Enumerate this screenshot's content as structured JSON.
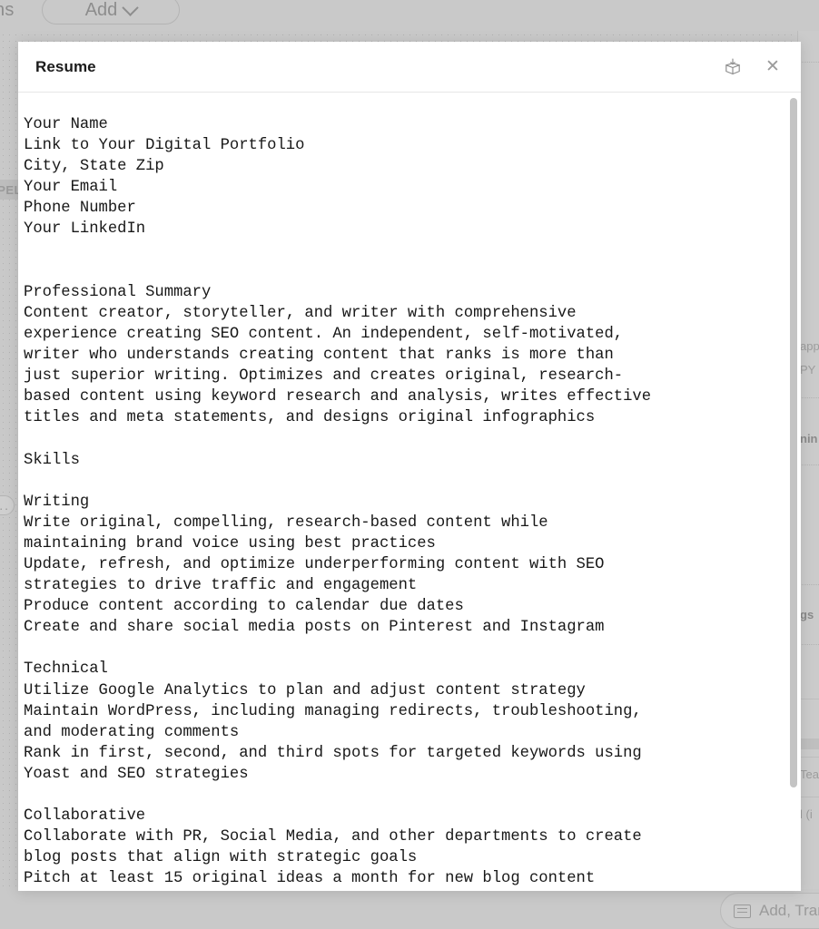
{
  "background": {
    "toolbar_fragment_label": "ns",
    "add_button_label": "Add",
    "add_button_icon": "chevron-down-icon",
    "left_panel_fragment": "PEL",
    "left_pill_label": "..",
    "right_fragments": [
      "app",
      "PY",
      "nin",
      "gs",
      "Tea",
      "l (i"
    ],
    "transfer_button_label": "Add, Transfe",
    "transfer_button_icon": "note-icon"
  },
  "modal": {
    "title": "Resume",
    "archive_icon": "archive-box-download-icon",
    "close_icon": "close-icon",
    "scrollbar": {
      "orientation": "vertical",
      "thumb_position_percent": 0
    },
    "document": {
      "content": "Your Name\nLink to Your Digital Portfolio\nCity, State Zip\nYour Email\nPhone Number\nYour LinkedIn\n\n\nProfessional Summary\nContent creator, storyteller, and writer with comprehensive\nexperience creating SEO content. An independent, self-motivated,\nwriter who understands creating content that ranks is more than\njust superior writing. Optimizes and creates original, research-\nbased content using keyword research and analysis, writes effective\ntitles and meta statements, and designs original infographics\n\nSkills\n\nWriting\nWrite original, compelling, research-based content while\nmaintaining brand voice using best practices\nUpdate, refresh, and optimize underperforming content with SEO\nstrategies to drive traffic and engagement\nProduce content according to calendar due dates\nCreate and share social media posts on Pinterest and Instagram\n\nTechnical\nUtilize Google Analytics to plan and adjust content strategy\nMaintain WordPress, including managing redirects, troubleshooting,\nand moderating comments\nRank in first, second, and third spots for targeted keywords using\nYoast and SEO strategies\n\nCollaborative\nCollaborate with PR, Social Media, and other departments to create\nblog posts that align with strategic goals\nPitch at least 15 original ideas a month for new blog content"
    }
  }
}
